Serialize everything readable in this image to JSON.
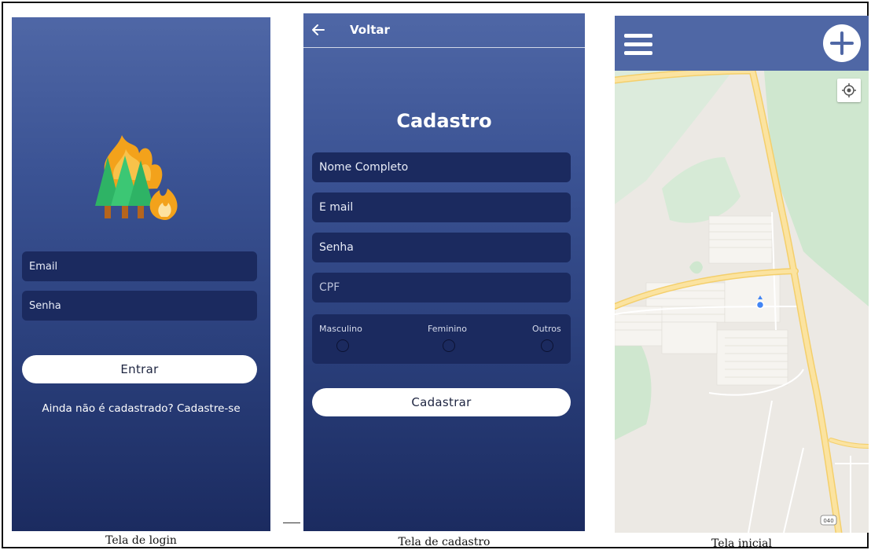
{
  "login": {
    "email_placeholder": "Email",
    "password_placeholder": "Senha",
    "enter_label": "Entrar",
    "signup_link": "Ainda não é cadastrado? Cadastre-se",
    "caption": "Tela de login",
    "logo_icon": "forest-fire-icon"
  },
  "cadastro": {
    "back_label": "Voltar",
    "title": "Cadastro",
    "fields": [
      "Nome Completo",
      "E mail",
      "Senha",
      "CPF"
    ],
    "genders": [
      "Masculino",
      "Feminino",
      "Outros"
    ],
    "submit_label": "Cadastrar",
    "caption": "Tela de cadastro"
  },
  "mapa": {
    "caption": "Tela inicial",
    "road_label": "040"
  },
  "colors": {
    "header_blue": "#4f67a5",
    "field_navy": "#1b2a5f",
    "gradient_bottom": "#1b2b60",
    "map_land": "#ece9e4",
    "map_green": "#cfe7cf",
    "road_yellow": "#f9dd8a",
    "location_dot": "#4285f4"
  }
}
